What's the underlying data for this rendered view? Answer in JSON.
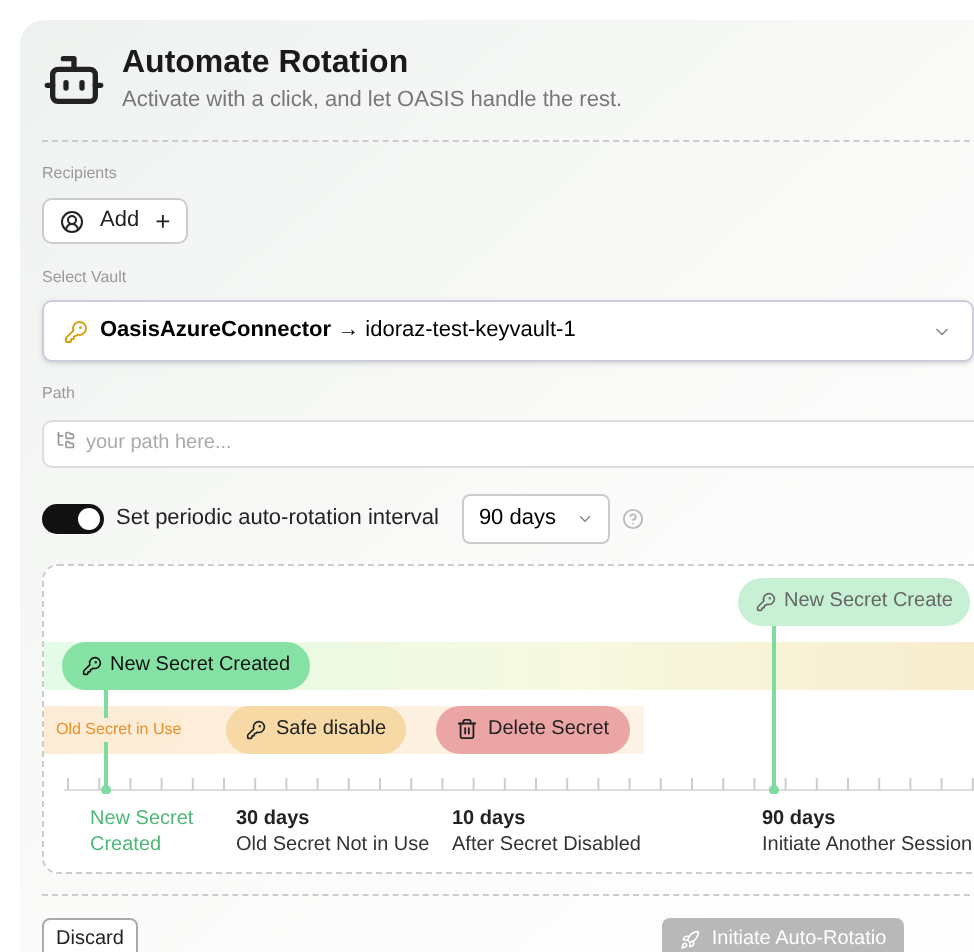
{
  "header": {
    "title": "Automate Rotation",
    "subtitle": "Activate with a click, and let OASIS handle the rest."
  },
  "recipients": {
    "label": "Recipients",
    "add_button": "Add",
    "plus": "+"
  },
  "vault": {
    "label": "Select Vault",
    "connector": "OasisAzureConnector",
    "arrow": "→",
    "vault_name": "idoraz-test-keyvault-1"
  },
  "path": {
    "label": "Path",
    "placeholder": "your path here..."
  },
  "interval": {
    "on": true,
    "label": "Set periodic auto-rotation interval",
    "value": "90 days"
  },
  "timeline": {
    "next_event": "New Secret Create",
    "current_event": "New Secret Created",
    "old_label": "Old Secret in Use",
    "safe_disable": "Safe disable",
    "delete": "Delete Secret",
    "milestones": [
      {
        "title": "New Secret Created",
        "highlight": true
      },
      {
        "title": "30 days",
        "text": "Old Secret Not in Use",
        "highlight": false
      },
      {
        "title": "10 days",
        "text": "After Secret Disabled",
        "highlight": false
      },
      {
        "title": "90 days",
        "text": "Initiate Another Session",
        "highlight": false
      }
    ]
  },
  "footer": {
    "discard": "Discard",
    "initiate": "Initiate Auto-Rotatio",
    "initiate_disabled": true
  }
}
